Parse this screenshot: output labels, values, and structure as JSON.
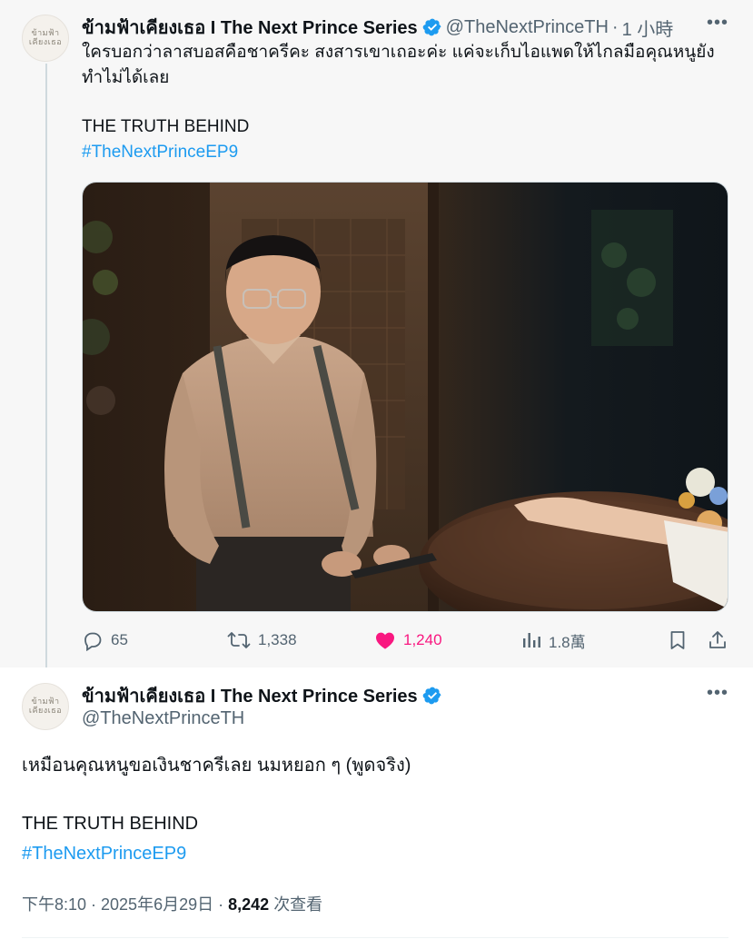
{
  "post1": {
    "author": {
      "name": "ข้ามฟ้าเคียงเธอ I The Next Prince Series",
      "handle": "@TheNextPrinceTH",
      "time": "1 小時",
      "avatar_text_1": "ข้ามฟ้า",
      "avatar_text_2": "เคียงเธอ"
    },
    "text_line1": "ใครบอกว่าลาสบอสคือชาครีคะ สงสารเขาเถอะค่ะ แค่จะเก็บไอแพดให้ไกลมือคุณหนูยัง",
    "text_line2": "ทำไม่ได้เลย",
    "text_line3": "THE TRUTH BEHIND",
    "hashtag": "#TheNextPrinceEP9",
    "stats": {
      "replies": "65",
      "reposts": "1,338",
      "likes": "1,240",
      "views": "1.8萬"
    },
    "liked": true
  },
  "post2": {
    "author": {
      "name": "ข้ามฟ้าเคียงเธอ I The Next Prince Series",
      "handle": "@TheNextPrinceTH",
      "avatar_text_1": "ข้ามฟ้า",
      "avatar_text_2": "เคียงเธอ"
    },
    "text_line1": "เหมือนคุณหนูขอเงินชาครีเลย นมหยอก ๆ (พูดจริง)",
    "text_line3": "THE TRUTH BEHIND",
    "hashtag": "#TheNextPrinceEP9",
    "meta_time": "下午8:10 · 2025年6月29日 ·",
    "meta_views_count": "8,242",
    "meta_views_label": "次查看"
  },
  "colors": {
    "accent": "#1d9bf0",
    "like": "#f91880",
    "muted": "#536471"
  },
  "icons": [
    "verified-badge-icon",
    "more-icon",
    "reply-icon",
    "repost-icon",
    "like-icon",
    "views-icon",
    "bookmark-icon",
    "share-icon"
  ]
}
